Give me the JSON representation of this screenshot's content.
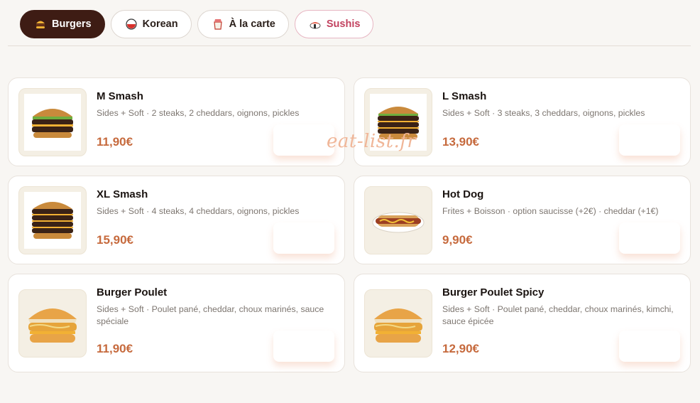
{
  "tabs": [
    {
      "label": "Burgers",
      "icon": "burger-icon"
    },
    {
      "label": "Korean",
      "icon": "bowl-icon"
    },
    {
      "label": "À la carte",
      "icon": "takeout-box-icon"
    },
    {
      "label": "Sushis",
      "icon": "sushi-icon"
    }
  ],
  "active_tab": "Burgers",
  "colors": {
    "active_tab_bg": "#3e1c14",
    "price": "#c66a3d",
    "sushi_tab": "#c2425f"
  },
  "items": [
    {
      "name": "M Smash",
      "description": "Sides + Soft · 2 steaks, 2 cheddars, oignons, pickles",
      "price": "11,90€",
      "image": "double-smash-burger-image"
    },
    {
      "name": "L Smash",
      "description": "Sides + Soft · 3 steaks, 3 cheddars, oignons, pickles",
      "price": "13,90€",
      "image": "triple-smash-burger-image"
    },
    {
      "name": "XL Smash",
      "description": "Sides + Soft · 4 steaks, 4 cheddars, oignons, pickles",
      "price": "15,90€",
      "image": "quad-smash-burger-image"
    },
    {
      "name": "Hot Dog",
      "description": "Frites + Boisson · option saucisse (+2€) · cheddar (+1€)",
      "price": "9,90€",
      "image": "hot-dog-image"
    },
    {
      "name": "Burger Poulet",
      "description": "Sides + Soft · Poulet pané, cheddar, choux marinés, sauce spéciale",
      "price": "11,90€",
      "image": "chicken-burger-image"
    },
    {
      "name": "Burger Poulet Spicy",
      "description": "Sides + Soft · Poulet pané, cheddar, choux marinés, kimchi, sauce épicée",
      "price": "12,90€",
      "image": "spicy-chicken-burger-image"
    }
  ],
  "watermark": "eat-list.fr"
}
